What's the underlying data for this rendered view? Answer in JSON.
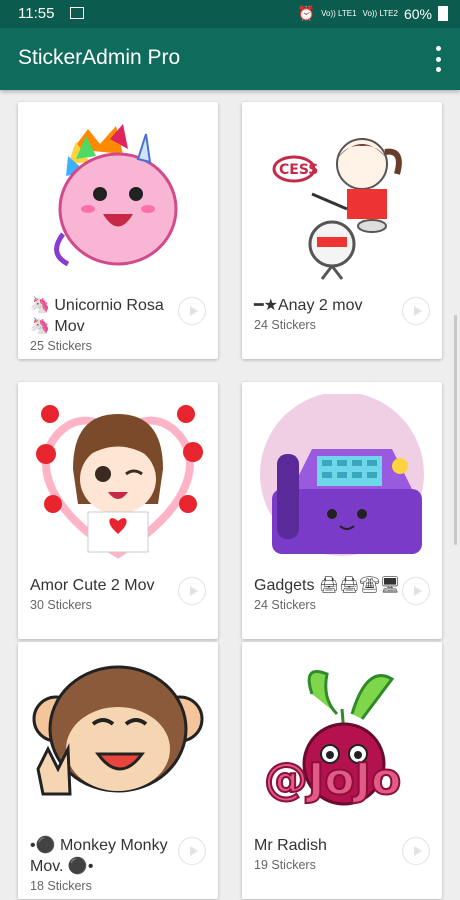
{
  "status": {
    "time": "11:55",
    "signal1": "Vo)) LTE1",
    "signal2": "Vo)) LTE2",
    "battery": "60%"
  },
  "app": {
    "title": "StickerAdmin Pro"
  },
  "packs": [
    {
      "name": "🦄 Unicornio Rosa 🦄 Mov",
      "count": "25 Stickers"
    },
    {
      "name": "━★Anay 2 mov",
      "count": "24 Stickers"
    },
    {
      "name": "Amor Cute 2 Mov",
      "count": "30 Stickers"
    },
    {
      "name": "Gadgets 🖨🖨☎🖥",
      "count": "24 Stickers"
    },
    {
      "name": "•⚫ Monkey Monky Mov. ⚫•",
      "count": "18 Stickers"
    },
    {
      "name": "Mr Radish",
      "count": "19 Stickers"
    }
  ],
  "colors": {
    "statusbar": "#0b5b4e",
    "appbar": "#0f6b5c",
    "background": "#eeeeee"
  }
}
